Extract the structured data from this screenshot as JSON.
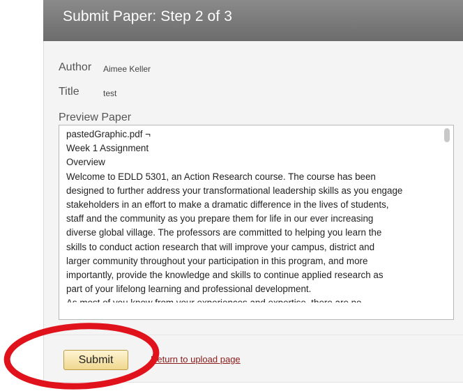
{
  "header": {
    "title": "Submit Paper: Step 2 of 3"
  },
  "fields": {
    "author_label": "Author",
    "author_value": "Aimee Keller",
    "title_label": "Title",
    "title_value": "test"
  },
  "preview": {
    "heading": "Preview Paper",
    "lines": [
      "pastedGraphic.pdf ¬",
      "Week 1 Assignment",
      "Overview",
      "Welcome to EDLD 5301, an Action Research course. The course has been",
      "designed to further address your transformational leadership skills as you engage",
      "stakeholders in an effort to make a dramatic difference in the lives of students,",
      "staff and the community as you prepare them for life in our ever increasing",
      "diverse global village. The professors are committed to helping you learn the",
      "skills to conduct action research that will improve your campus, district and",
      "larger community throughout your participation in this program, and more",
      "importantly, provide the knowledge and skills to continue applied research as",
      "part of your lifelong learning and professional development.",
      "As most of you know from your experiences and expertise, there are no"
    ]
  },
  "actions": {
    "submit_label": "Submit",
    "return_label": "Return to upload page"
  },
  "colors": {
    "header": "#7a7a7a",
    "annotation": "#e0121b",
    "link": "#8a1a1a",
    "button": "#f3dea0"
  }
}
